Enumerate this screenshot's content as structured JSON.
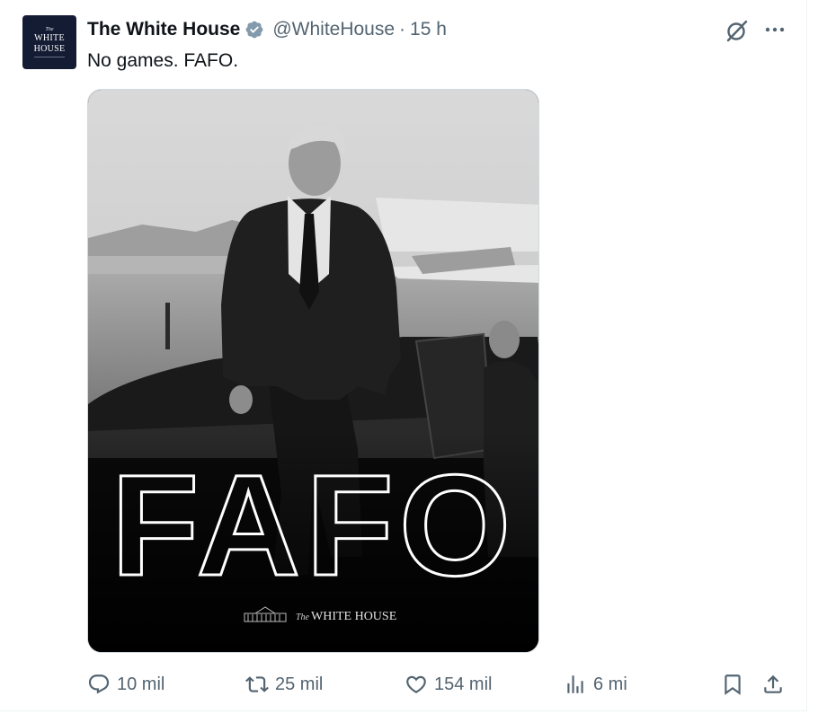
{
  "post": {
    "author_name": "The White House",
    "handle": "@WhiteHouse",
    "separator": "·",
    "time": "15 h",
    "text": "No games. FAFO.",
    "avatar": {
      "line1": "The",
      "line2": "WHITE",
      "line3": "HOUSE"
    },
    "image": {
      "overlay_text": "FAFO",
      "brand_prefix": "The",
      "brand_text": "WHITE HOUSE"
    }
  },
  "actions": {
    "replies": "10 mil",
    "reposts": "25 mil",
    "likes": "154 mil",
    "views": "6 mi"
  },
  "icons": {
    "verified": "verified-badge-icon",
    "grok": "grok-icon",
    "more": "more-icon",
    "reply": "reply-icon",
    "repost": "repost-icon",
    "like": "heart-icon",
    "views": "views-icon",
    "bookmark": "bookmark-icon",
    "share": "share-icon"
  },
  "colors": {
    "secondary_text": "#536471",
    "primary_text": "#0f1419",
    "verified_gray": "#829aab",
    "avatar_bg": "#141c33"
  }
}
